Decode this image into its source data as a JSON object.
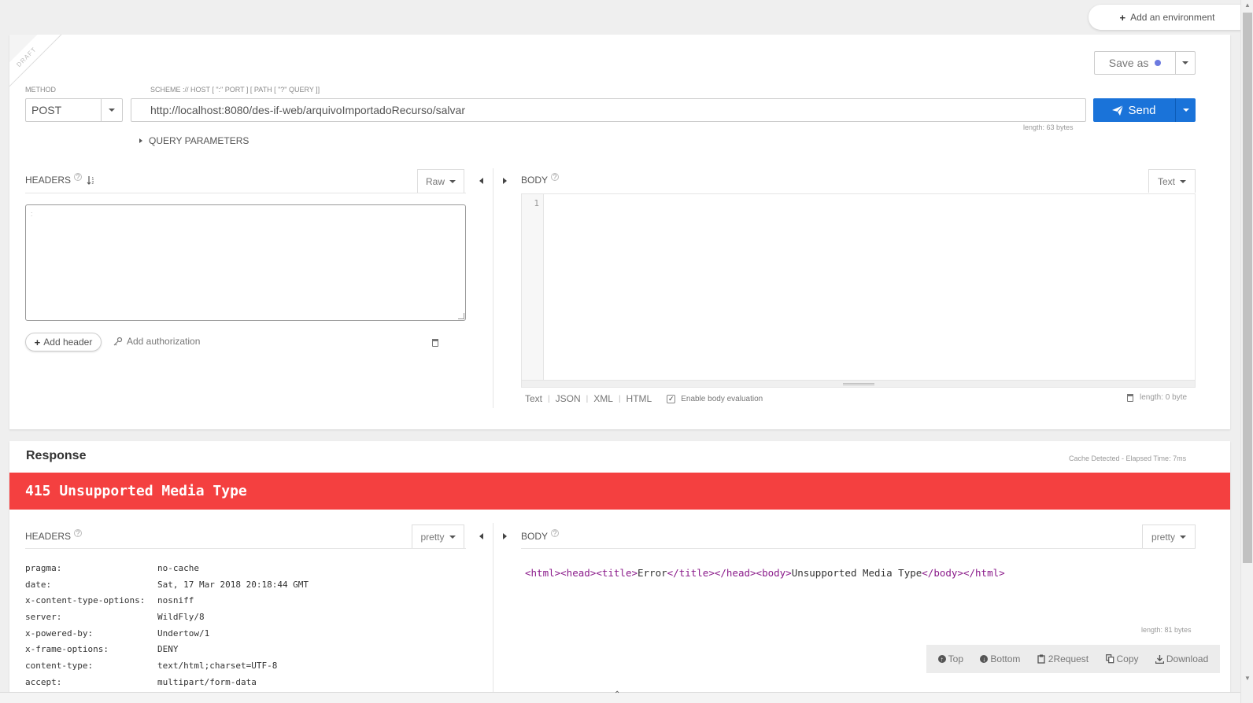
{
  "env": {
    "add_label": "Add an environment"
  },
  "request": {
    "draft_label": "DRAFT",
    "method_label": "METHOD",
    "method_value": "POST",
    "url_label": "SCHEME :// HOST [ \":\" PORT ] [ PATH [ \"?\" QUERY ]]",
    "url_value": "http://localhost:8080/des-if-web/arquivoImportadoRecurso/salvar",
    "url_length": "length: 63 bytes",
    "save_label": "Save as",
    "send_label": "Send",
    "query_params_label": "QUERY PARAMETERS",
    "headers": {
      "title": "HEADERS",
      "mode": "Raw",
      "placeholder": ":",
      "add_header_label": "Add header",
      "add_auth_label": "Add authorization"
    },
    "body": {
      "title": "BODY",
      "mode": "Text",
      "line_number": "1",
      "modes": [
        "Text",
        "JSON",
        "XML",
        "HTML"
      ],
      "eval_label": "Enable body evaluation",
      "eval_checked": true,
      "length": "length: 0 byte"
    }
  },
  "response": {
    "title": "Response",
    "cache_info": "Cache Detected - Elapsed Time: 7ms",
    "status_text": "415 Unsupported Media Type",
    "status_color": "#f44040",
    "headers_title": "HEADERS",
    "headers_mode": "pretty",
    "body_title": "BODY",
    "body_mode": "pretty",
    "headers": [
      {
        "key": "pragma:",
        "value": "no-cache"
      },
      {
        "key": "date:",
        "value": "Sat, 17 Mar 2018 20:18:44 GMT"
      },
      {
        "key": "x-content-type-options:",
        "value": "nosniff"
      },
      {
        "key": "server:",
        "value": "WildFly/8"
      },
      {
        "key": "x-powered-by:",
        "value": "Undertow/1"
      },
      {
        "key": "x-frame-options:",
        "value": "DENY"
      },
      {
        "key": "content-type:",
        "value": "text/html;charset=UTF-8"
      },
      {
        "key": "accept:",
        "value": "multipart/form-data"
      }
    ],
    "body_parts": {
      "t1": "<html>",
      "t2": "<head>",
      "t3": "<title>",
      "txt1": "Error",
      "t4": "</title>",
      "t5": "</head>",
      "t6": "<body>",
      "txt2": "Unsupported Media Type",
      "t7": "</body>",
      "t8": "</html>"
    },
    "body_length": "length: 81 bytes",
    "actions": {
      "top": "Top",
      "bottom": "Bottom",
      "to_request": "2Request",
      "copy": "Copy",
      "download": "Download"
    }
  }
}
